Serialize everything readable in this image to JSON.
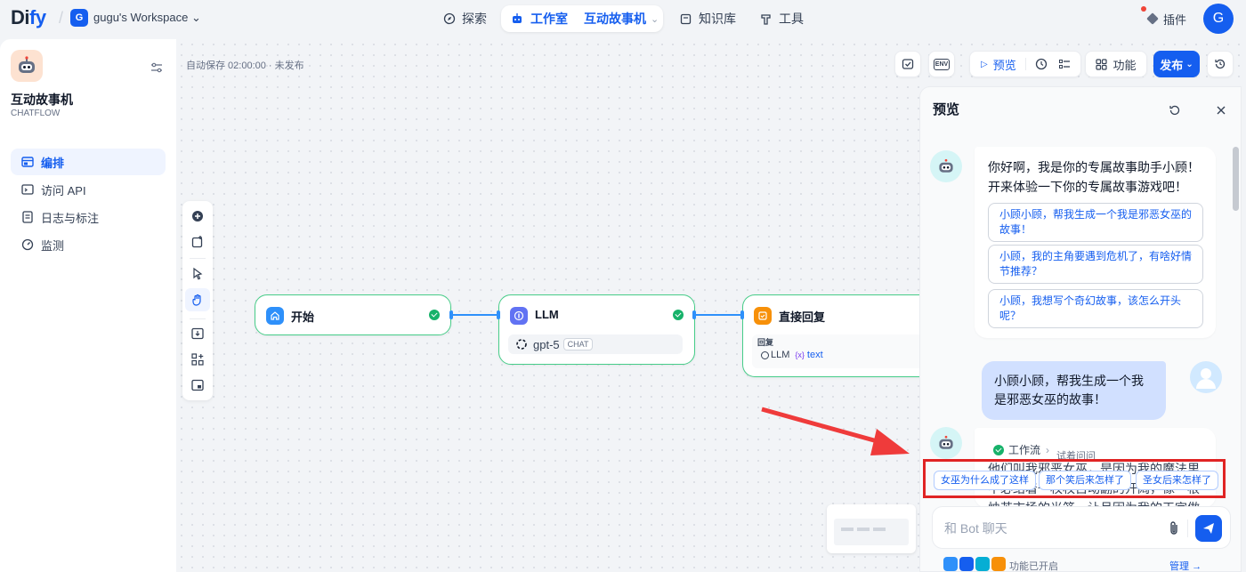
{
  "topbar": {
    "logo_main": "Di",
    "logo_accent": "fy",
    "workspace_initial": "G",
    "workspace_name": "gugu's Workspace",
    "nav": {
      "explore": "探索",
      "studio": "工作室",
      "current_app": "互动故事机",
      "knowledge": "知识库",
      "tools": "工具"
    },
    "plugins": "插件",
    "user_initial": "G"
  },
  "sidebar": {
    "app_name": "互动故事机",
    "app_mode": "CHATFLOW",
    "items": [
      {
        "label": "编排",
        "icon": "layout-icon",
        "active": true
      },
      {
        "label": "访问 API",
        "icon": "terminal-icon",
        "active": false
      },
      {
        "label": "日志与标注",
        "icon": "file-list-icon",
        "active": false
      },
      {
        "label": "监测",
        "icon": "dashboard-icon",
        "active": false
      }
    ]
  },
  "canvas": {
    "autosave": "自动保存 02:00:00 · 未发布",
    "toolbar": {
      "env": "ENV",
      "preview": "预览",
      "features": "功能",
      "publish": "发布"
    },
    "nodes": {
      "start": {
        "title": "开始"
      },
      "llm": {
        "title": "LLM",
        "model": "gpt-5",
        "model_tag": "CHAT"
      },
      "answer": {
        "title": "直接回复",
        "field_label": "回复",
        "var_source": "LLM",
        "var_name": "text",
        "var_prefix": "{x}"
      }
    }
  },
  "preview": {
    "title": "预览",
    "opening": "你好啊，我是你的专属故事助手小顾！开来体验一下你的专属故事游戏吧！",
    "suggestions": [
      "小顾小顾，帮我生成一个我是邪恶女巫的故事！",
      "小顾，我的主角要遇到危机了，有啥好情节推荐？",
      "小顾，我想写个奇幻故事，该怎么开头呢？"
    ],
    "user_message": "小顾小顾，帮我生成一个我是邪恶女巫的故事！",
    "workflow_label": "工作流",
    "try_ask": "试着问问",
    "answer_partial": "他们叫我邪恶女巫，是因为我的魔法里",
    "answer_partial2": "不必结着一枚枚自动翻的开阔，像一根",
    "answer_partial3": "烛芯市场的光笼，让月因为我的王宇做",
    "followups": [
      "女巫为什么成了这样",
      "那个笑后来怎样了",
      "圣女后来怎样了"
    ],
    "input_placeholder": "和 Bot 聊天",
    "features_enabled": "功能已开启",
    "manage": "管理"
  },
  "colors": {
    "accent": "#155eef",
    "node_border": "#47cd89",
    "highlight": "#e02424"
  }
}
